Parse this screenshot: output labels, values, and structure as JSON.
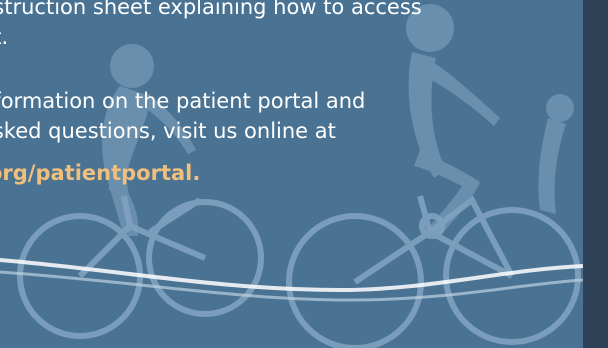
{
  "page": {
    "text_line_1": "nstruction sheet explaining how to access",
    "text_line_2": "nt.",
    "text_line_3": "nformation on the patient portal and",
    "text_line_4": "asked questions, visit us online at",
    "link_text": ".org/patientportal."
  },
  "colors": {
    "background": "#4a7393",
    "sidebar": "#2e4157",
    "silhouette": "#7fa2bf",
    "link": "#f0bf7c"
  }
}
